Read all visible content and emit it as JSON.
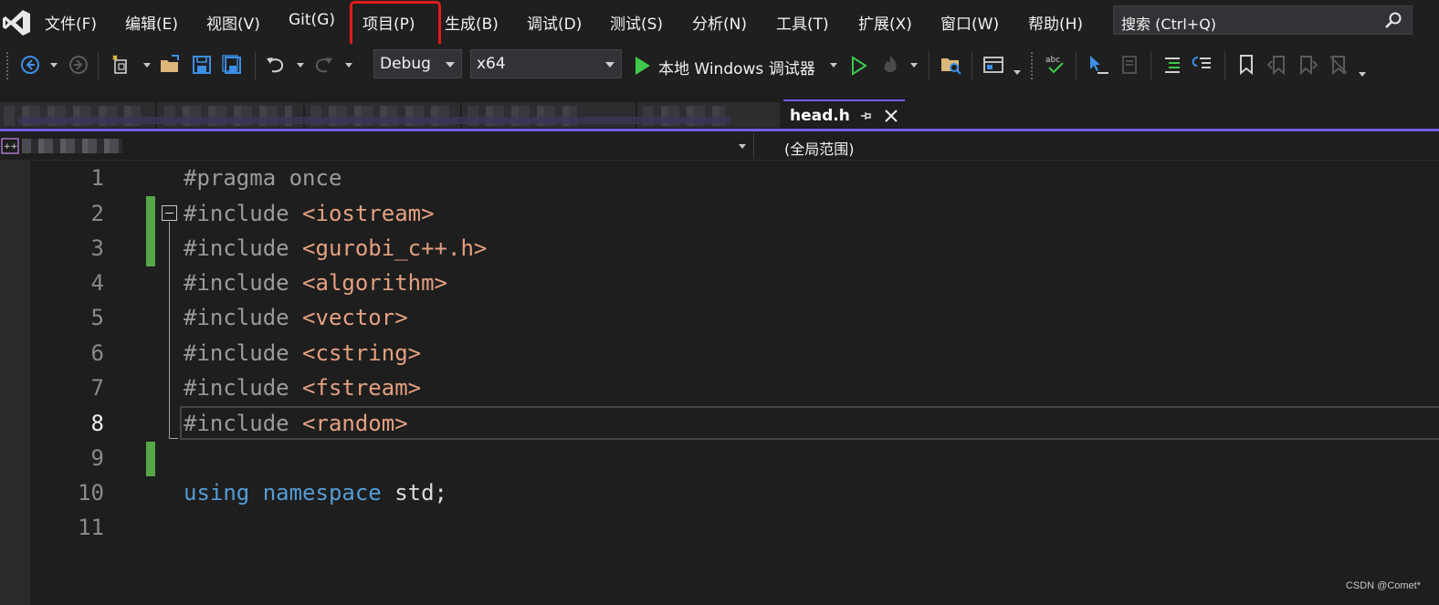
{
  "menubar": {
    "items": [
      "文件(F)",
      "编辑(E)",
      "视图(V)",
      "Git(G)",
      "项目(P)",
      "生成(B)",
      "调试(D)",
      "测试(S)",
      "分析(N)",
      "工具(T)",
      "扩展(X)",
      "窗口(W)",
      "帮助(H)"
    ],
    "search_placeholder": "搜索 (Ctrl+Q)"
  },
  "toolbar": {
    "configuration": "Debug",
    "platform": "x64",
    "run_label": "本地 Windows 调试器"
  },
  "tabs": {
    "active_label": "head.h"
  },
  "navbar": {
    "scope": "(全局范围)"
  },
  "editor": {
    "line_numbers": [
      "1",
      "2",
      "3",
      "4",
      "5",
      "6",
      "7",
      "8",
      "9",
      "10",
      "11"
    ],
    "current_line": "8",
    "lines": [
      {
        "pre": "#pragma once",
        "inc": ""
      },
      {
        "pre": "#include ",
        "inc": "<iostream>"
      },
      {
        "pre": "#include ",
        "inc": "<gurobi_c++.h>"
      },
      {
        "pre": "#include ",
        "inc": "<algorithm>"
      },
      {
        "pre": "#include ",
        "inc": "<vector>"
      },
      {
        "pre": "#include ",
        "inc": "<cstring>"
      },
      {
        "pre": "#include ",
        "inc": "<fstream>"
      },
      {
        "pre": "#include ",
        "inc": "<random>"
      }
    ],
    "using_kw": "using",
    "namespace_kw": "namespace",
    "std_rest": " std;"
  },
  "watermark": "CSDN @Comet*",
  "colors": {
    "accent": "#7160e8",
    "highlight": "#e31a1a",
    "change_bar": "#57a64a",
    "run_green": "#3ec94a"
  }
}
